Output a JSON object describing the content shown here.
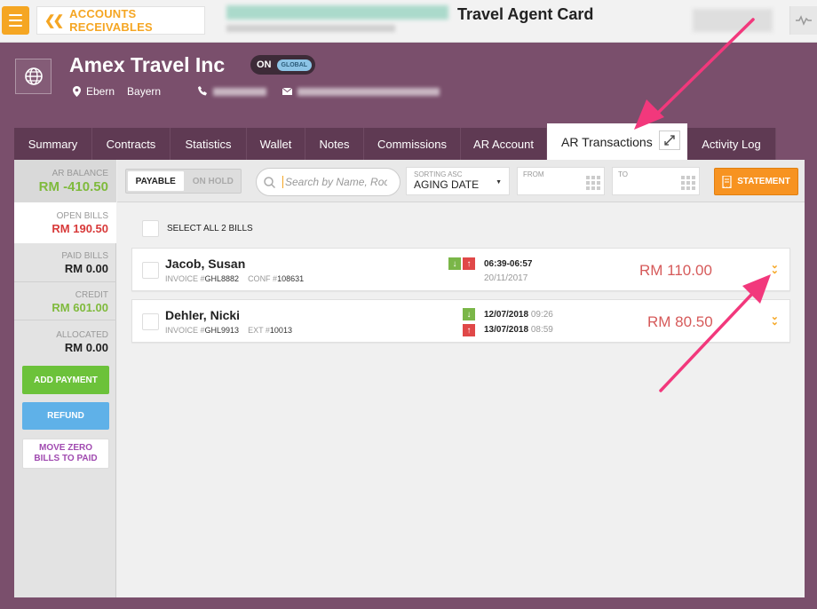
{
  "topbar": {
    "back_label": "ACCOUNTS RECEIVABLES",
    "title": "Travel Agent Card"
  },
  "agent": {
    "name": "Amex Travel Inc",
    "toggle_on": "ON",
    "toggle_global": "GLOBAL",
    "city": "Ebern",
    "region": "Bayern"
  },
  "tabs": [
    {
      "label": "Summary"
    },
    {
      "label": "Contracts"
    },
    {
      "label": "Statistics"
    },
    {
      "label": "Wallet"
    },
    {
      "label": "Notes"
    },
    {
      "label": "Commissions"
    },
    {
      "label": "AR Account"
    },
    {
      "label": "AR Transactions"
    },
    {
      "label": "Activity Log"
    }
  ],
  "sidebar": {
    "ar_balance_label": "AR BALANCE",
    "ar_balance_value": "RM -410.50",
    "open_bills_label": "OPEN BILLS",
    "open_bills_value": "RM 190.50",
    "paid_bills_label": "PAID BILLS",
    "paid_bills_value": "RM 0.00",
    "credit_label": "CREDIT",
    "credit_value": "RM 601.00",
    "allocated_label": "ALLOCATED",
    "allocated_value": "RM 0.00",
    "add_payment": "ADD PAYMENT",
    "refund": "REFUND",
    "move_zero_line1": "MOVE ZERO",
    "move_zero_line2": "BILLS TO PAID"
  },
  "toolbar": {
    "payable": "PAYABLE",
    "on_hold": "ON HOLD",
    "search_placeholder": "Search by Name, Room",
    "sort_label": "SORTING ASC",
    "sort_value": "AGING DATE",
    "from_label": "FROM",
    "to_label": "TO",
    "statement": "STATEMENT"
  },
  "select_all_label": "SELECT ALL 2 BILLS",
  "bills": [
    {
      "name": "Jacob, Susan",
      "invoice_label": "INVOICE #",
      "invoice": "GHL8882",
      "ref_label": "CONF #",
      "ref": "108631",
      "time": "06:39-06:57",
      "date": "20/11/2017",
      "amount": "RM 110.00"
    },
    {
      "name": "Dehler, Nicki",
      "invoice_label": "INVOICE #",
      "invoice": "GHL9913",
      "ref_label": "EXT #",
      "ref": "10013",
      "arrival_date": "12/07/2018",
      "arrival_time": "09:26",
      "departure_date": "13/07/2018",
      "departure_time": "08:59",
      "amount": "RM 80.50"
    }
  ],
  "colors": {
    "brand_orange": "#f5a623",
    "purple_bg": "#7a4f6c",
    "tab_bg": "#5f3a53",
    "positive_green": "#7fba3c",
    "negative_red": "#d83a3a",
    "annotation_pink": "#f2387c"
  }
}
